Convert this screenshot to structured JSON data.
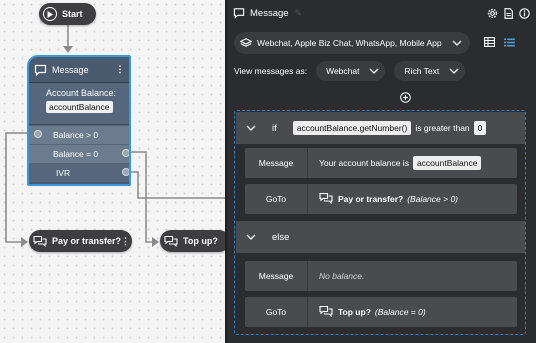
{
  "canvas": {
    "start_label": "Start",
    "message_node": {
      "title": "Message",
      "body_text": "Account Balance:",
      "variable": "accountBalance",
      "branches": [
        "Balance > 0",
        "Balance = 0",
        "IVR"
      ]
    },
    "pay_node_label": "Pay or transfer?",
    "topup_node_label": "Top up?"
  },
  "panel": {
    "title": "Message",
    "channels": "Webchat, Apple Biz Chat, WhatsApp, Mobile App",
    "view_as_label": "View messages as:",
    "view_channel": "Webchat",
    "view_format": "Rich Text",
    "if_block": {
      "keyword": "if",
      "expression": "accountBalance.getNumber()",
      "operator": "is greater than",
      "value": "0",
      "message_key": "Message",
      "message_text": "Your account balance is",
      "message_var": "accountBalance",
      "goto_key": "GoTo",
      "goto_target": "Pay or transfer?",
      "goto_condition": "(Balance > 0)"
    },
    "else_block": {
      "keyword": "else",
      "message_key": "Message",
      "message_text": "No balance.",
      "goto_key": "GoTo",
      "goto_target": "Top up?",
      "goto_condition": "(Balance = 0)"
    }
  },
  "colors": {
    "node_dark": "#3e3e40",
    "message_node": "#4a5a6f",
    "selection_blue": "#3d97d6",
    "panel_bg": "#2b2c2f",
    "toggle_active": "#4a9fe0"
  },
  "icons": [
    "play-circle-icon",
    "chat-bubble-icon",
    "kebab-menu-icon",
    "gear-icon",
    "document-icon",
    "info-icon",
    "layers-icon",
    "chevron-down-icon",
    "table-view-icon",
    "list-view-icon",
    "add-circle-icon",
    "chat-bubbles-icon",
    "pencil-icon"
  ]
}
